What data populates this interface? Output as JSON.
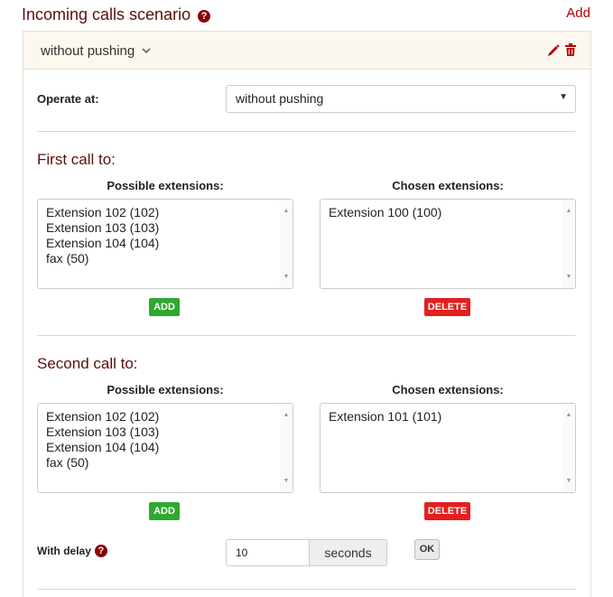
{
  "header": {
    "title": "Incoming calls scenario",
    "add_label": "Add"
  },
  "scenario": {
    "name": "without pushing"
  },
  "operate": {
    "label": "Operate at:",
    "selected": "without pushing"
  },
  "first_call": {
    "title": "First call to:",
    "possible_label": "Possible extensions:",
    "chosen_label": "Chosen extensions:",
    "possible": [
      "Extension 102 (102)",
      "Extension 103 (103)",
      "Extension 104 (104)",
      "fax (50)"
    ],
    "chosen": [
      "Extension 100 (100)"
    ],
    "add_label": "ADD",
    "delete_label": "DELETE"
  },
  "second_call": {
    "title": "Second call to:",
    "possible_label": "Possible extensions:",
    "chosen_label": "Chosen extensions:",
    "possible": [
      "Extension 102 (102)",
      "Extension 103 (103)",
      "Extension 104 (104)",
      "fax (50)"
    ],
    "chosen": [
      "Extension 101 (101)"
    ],
    "add_label": "ADD",
    "delete_label": "DELETE"
  },
  "delay": {
    "label": "With delay",
    "value": "10",
    "unit": "seconds",
    "ok_label": "OK"
  },
  "colors": {
    "title": "#5a0f0f",
    "accent": "#b50000",
    "add_button": "#2fa82f",
    "delete_button": "#e61e1e"
  },
  "icons": {
    "help": "question-circle-icon",
    "edit": "pencil-icon",
    "delete": "trash-icon",
    "toggle": "chevron-down-icon"
  }
}
